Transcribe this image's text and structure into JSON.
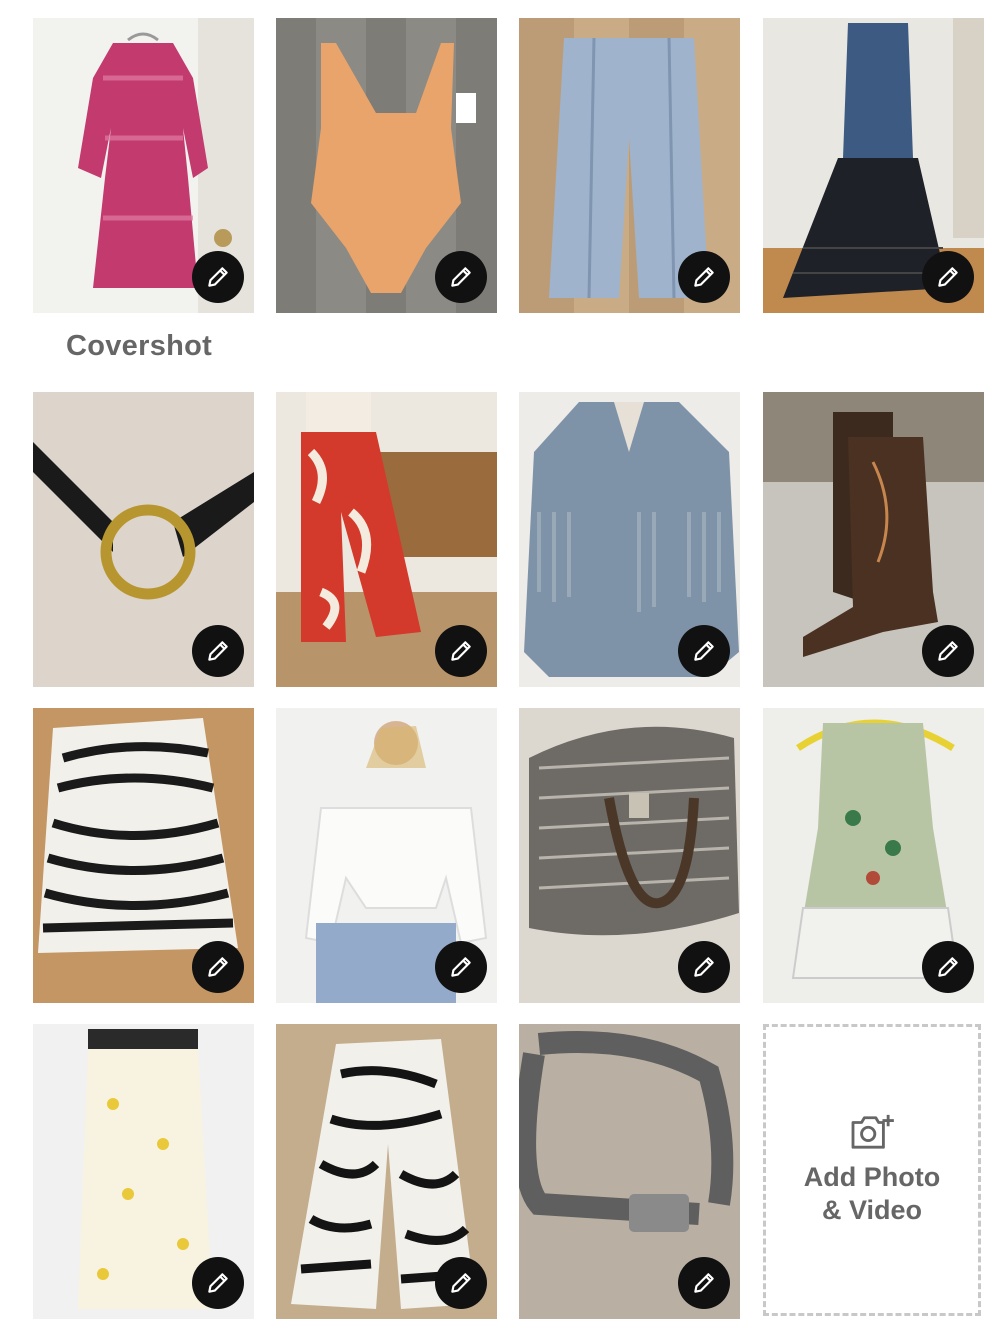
{
  "labels": {
    "covershot": "Covershot",
    "add_media": "Add Photo\n& Video"
  },
  "photos": [
    {
      "item": "pink-print-dress",
      "icon": "pencil-icon"
    },
    {
      "item": "orange-swimsuit",
      "icon": "pencil-icon"
    },
    {
      "item": "light-wash-jeans",
      "icon": "pencil-icon"
    },
    {
      "item": "denim-vest-mesh-skirt",
      "icon": "pencil-icon"
    },
    {
      "item": "black-ring-belt",
      "icon": "pencil-icon"
    },
    {
      "item": "red-floral-pants",
      "icon": "pencil-icon"
    },
    {
      "item": "fringe-denim-jacket",
      "icon": "pencil-icon"
    },
    {
      "item": "cowboy-boots",
      "icon": "pencil-icon"
    },
    {
      "item": "zebra-skirt",
      "icon": "pencil-icon"
    },
    {
      "item": "white-eyelet-top",
      "icon": "pencil-icon"
    },
    {
      "item": "houndstooth-bag",
      "icon": "pencil-icon"
    },
    {
      "item": "floral-lace-top",
      "icon": "pencil-icon"
    },
    {
      "item": "yellow-floral-skirt",
      "icon": "pencil-icon"
    },
    {
      "item": "zebra-leaf-pants",
      "icon": "pencil-icon"
    },
    {
      "item": "silver-concho-belt",
      "icon": "pencil-icon"
    }
  ],
  "colors": {
    "edit_button_bg": "#111111",
    "label_text": "#666666",
    "dashed_border": "#c8c8c8"
  },
  "add_icon": "camera-plus-icon"
}
